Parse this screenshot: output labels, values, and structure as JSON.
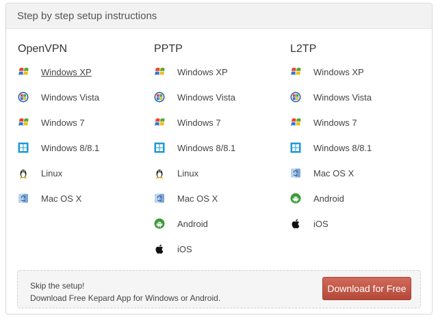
{
  "header": {
    "title": "Step by step setup instructions"
  },
  "columns": [
    {
      "title": "OpenVPN",
      "items": [
        {
          "label": "Windows XP",
          "icon": "windows-xp-icon"
        },
        {
          "label": "Windows Vista",
          "icon": "windows-vista-icon"
        },
        {
          "label": "Windows 7",
          "icon": "windows-7-icon"
        },
        {
          "label": "Windows 8/8.1",
          "icon": "windows-8-icon"
        },
        {
          "label": "Linux",
          "icon": "linux-icon"
        },
        {
          "label": "Mac OS X",
          "icon": "mac-os-x-icon"
        }
      ]
    },
    {
      "title": "PPTP",
      "items": [
        {
          "label": "Windows XP",
          "icon": "windows-xp-icon"
        },
        {
          "label": "Windows Vista",
          "icon": "windows-vista-icon"
        },
        {
          "label": "Windows 7",
          "icon": "windows-7-icon"
        },
        {
          "label": "Windows 8/8.1",
          "icon": "windows-8-icon"
        },
        {
          "label": "Linux",
          "icon": "linux-icon"
        },
        {
          "label": "Mac OS X",
          "icon": "mac-os-x-icon"
        },
        {
          "label": "Android",
          "icon": "android-icon"
        },
        {
          "label": "iOS",
          "icon": "apple-icon"
        }
      ]
    },
    {
      "title": "L2TP",
      "items": [
        {
          "label": "Windows XP",
          "icon": "windows-xp-icon"
        },
        {
          "label": "Windows Vista",
          "icon": "windows-vista-icon"
        },
        {
          "label": "Windows 7",
          "icon": "windows-7-icon"
        },
        {
          "label": "Windows 8/8.1",
          "icon": "windows-8-icon"
        },
        {
          "label": "Mac OS X",
          "icon": "mac-os-x-icon"
        },
        {
          "label": "Android",
          "icon": "android-icon"
        },
        {
          "label": "iOS",
          "icon": "apple-icon"
        }
      ]
    }
  ],
  "promo": {
    "line1": "Skip the setup!",
    "line2": "Download Free Kepard App for Windows or Android.",
    "button_label": "Download for Free"
  },
  "colors": {
    "button": "#c05a4a",
    "header_bg": "#f2f2f2"
  }
}
